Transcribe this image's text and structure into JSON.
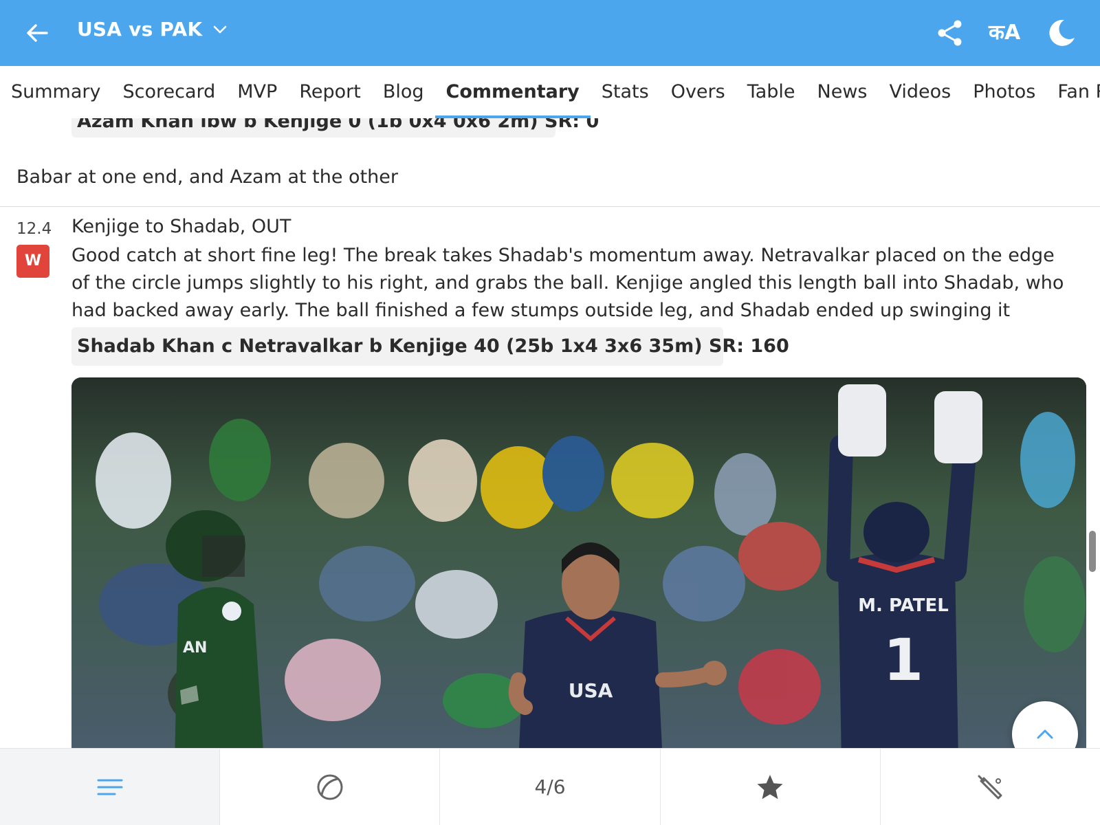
{
  "header": {
    "title": "USA vs PAK",
    "lang_label": "कA",
    "back_icon": "arrow-left-icon",
    "dropdown_icon": "chevron-down-icon",
    "share_icon": "share-icon",
    "theme_icon": "moon-icon",
    "bg_color": "#4ba6ee"
  },
  "tabs": [
    {
      "label": "Summary",
      "active": false
    },
    {
      "label": "Scorecard",
      "active": false
    },
    {
      "label": "MVP",
      "active": false
    },
    {
      "label": "Report",
      "active": false
    },
    {
      "label": "Blog",
      "active": false
    },
    {
      "label": "Commentary",
      "active": true
    },
    {
      "label": "Stats",
      "active": false
    },
    {
      "label": "Overs",
      "active": false
    },
    {
      "label": "Table",
      "active": false
    },
    {
      "label": "News",
      "active": false
    },
    {
      "label": "Videos",
      "active": false
    },
    {
      "label": "Photos",
      "active": false
    },
    {
      "label": "Fan Ra",
      "active": false
    }
  ],
  "commentary": {
    "previous_dismissal": "Azam Khan lbw b Kenjige 0 (1b 0x4 0x6 2m) SR: 0",
    "note": "Babar at one end, and Azam at the other",
    "ball": {
      "over": "12.4",
      "badge": "W",
      "headline": "Kenjige to Shadab, OUT",
      "text": "Good catch at short fine leg! The break takes Shadab's momentum away. Netravalkar placed on the edge of the circle jumps slightly to his right, and grabs the ball. Kenjige angled this length ball into Shadab, who had backed away early. The ball finished a few stumps outside leg, and Shadab ended up swinging it straight to the fielder",
      "dismissal": "Shadab Khan c Netravalkar b Kenjige 40 (25b 1x4 3x6 35m) SR: 160"
    },
    "photo": {
      "jersey_usa": "USA",
      "jersey_keeper_name": "M. PATEL",
      "jersey_keeper_number": "1",
      "jersey_pak": "AN"
    }
  },
  "scroll_top_icon": "chevron-up-icon",
  "bottom_nav": [
    {
      "icon": "menu-lines-icon",
      "label": ""
    },
    {
      "icon": "cricket-ball-icon",
      "label": ""
    },
    {
      "icon": "",
      "label": "4/6"
    },
    {
      "icon": "star-icon",
      "label": ""
    },
    {
      "icon": "cricket-bat-icon",
      "label": ""
    }
  ],
  "colors": {
    "accent": "#4ba6ee",
    "wicket": "#e0443b",
    "chip_bg": "#f2f2f2"
  }
}
